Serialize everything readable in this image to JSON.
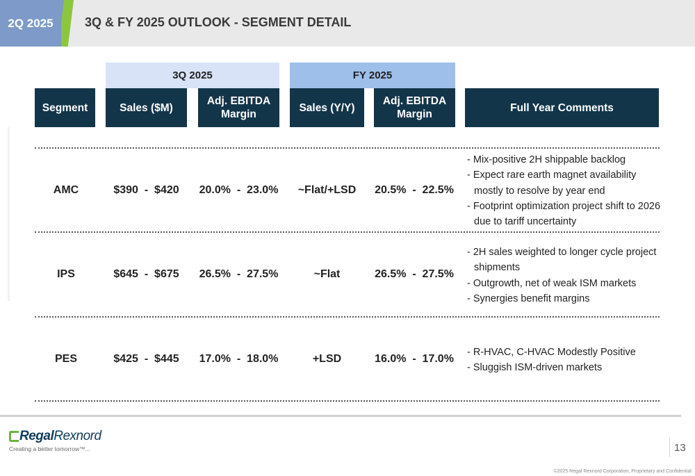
{
  "header": {
    "quarter_tab": "2Q 2025",
    "title": "3Q & FY 2025 OUTLOOK - SEGMENT DETAIL"
  },
  "groups": {
    "q3": "3Q 2025",
    "fy": "FY 2025"
  },
  "columns": {
    "segment": "Segment",
    "sales_3q": "Sales ($M)",
    "margin_3q_line1": "Adj. EBITDA",
    "margin_3q_line2": "Margin",
    "sales_fy": "Sales (Y/Y)",
    "margin_fy_line1": "Adj. EBITDA",
    "margin_fy_line2": "Margin",
    "comments": "Full Year Comments"
  },
  "rows": [
    {
      "segment": "AMC",
      "sales_3q": "$390  -  $420",
      "margin_3q": "20.0%  -  23.0%",
      "sales_fy": "~Flat/+LSD",
      "margin_fy": "20.5%  -  22.5%",
      "comments": [
        "Mix-positive 2H shippable backlog",
        "Expect rare earth magnet availability mostly to resolve by year end",
        "Footprint optimization project shift to 2026 due to tariff uncertainty"
      ]
    },
    {
      "segment": "IPS",
      "sales_3q": "$645  -  $675",
      "margin_3q": "26.5%  -  27.5%",
      "sales_fy": "~Flat",
      "margin_fy": "26.5%  -  27.5%",
      "comments": [
        "2H sales weighted to longer cycle project shipments",
        "Outgrowth, net of weak ISM markets",
        "Synergies benefit margins"
      ]
    },
    {
      "segment": "PES",
      "sales_3q": "$425  -  $445",
      "margin_3q": "17.0%  -  18.0%",
      "sales_fy": "+LSD",
      "margin_fy": "16.0%  -  17.0%",
      "comments": [
        "R-HVAC, C-HVAC Modestly Positive",
        "Sluggish ISM-driven markets"
      ]
    }
  ],
  "footer": {
    "logo_regal": "Regal",
    "logo_rexnord": "Rexnord",
    "tagline": "Creating a better tomorrow™...",
    "page_number": "13",
    "copyright": "©2025 Regal Rexnord Corporation, Proprietary and Confidential"
  },
  "colors": {
    "header_band": "#e9e9e9",
    "quarter_tab": "#7d9ac8",
    "accent_green": "#8cc63f",
    "group_3q": "#d8e3f7",
    "group_fy": "#9dbfe9",
    "column_header": "#13354a"
  }
}
